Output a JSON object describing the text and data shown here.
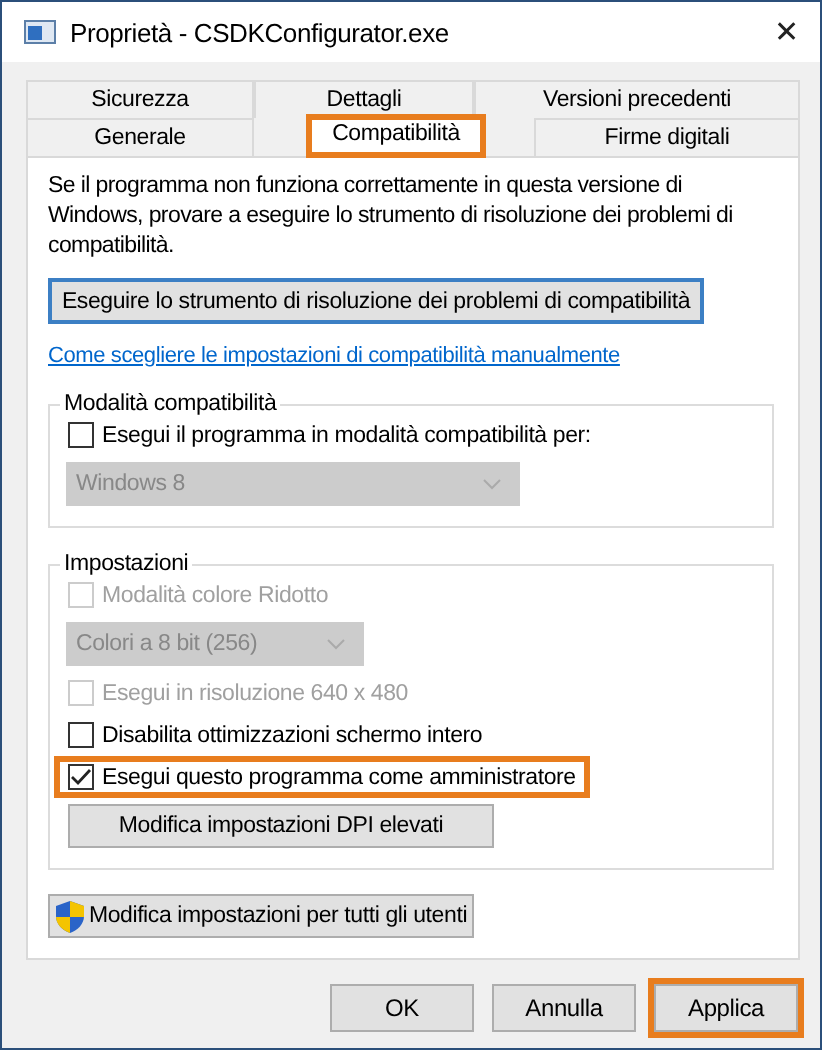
{
  "window": {
    "title": "Proprietà - CSDKConfigurator.exe",
    "close": "✕"
  },
  "tab_rows": [
    [
      {
        "label": "Sicurezza",
        "selected": false,
        "highlighted": false
      },
      {
        "label": "Dettagli",
        "selected": false,
        "highlighted": false
      },
      {
        "label": "Versioni precedenti",
        "selected": false,
        "highlighted": false
      }
    ],
    [
      {
        "label": "Generale",
        "selected": false,
        "highlighted": false
      },
      {
        "label": "Compatibilità",
        "selected": true,
        "highlighted": true
      },
      {
        "label": "Firme digitali",
        "selected": false,
        "highlighted": false
      }
    ]
  ],
  "intro": "Se il programma non funziona correttamente in questa versione di Windows, provare a eseguire lo strumento di risoluzione dei problemi di compatibilità.",
  "troubleshooter_button": "Eseguire lo strumento di risoluzione dei problemi di compatibilità",
  "manual_link": "Come scegliere le impostazioni di compatibilità manualmente",
  "groups": [
    {
      "title": "Modalità compatibilità",
      "items": [
        {
          "kind": "checkbox",
          "label": "Esegui il programma in modalità compatibilità per:",
          "checked": false,
          "disabled": false,
          "highlighted": false
        },
        {
          "kind": "dropdown",
          "value": "Windows 8",
          "disabled": true
        }
      ]
    },
    {
      "title": "Impostazioni",
      "items": [
        {
          "kind": "checkbox",
          "label": "Modalità colore Ridotto",
          "checked": false,
          "disabled": true,
          "highlighted": false
        },
        {
          "kind": "dropdown",
          "value": "Colori a 8 bit (256)",
          "disabled": true
        },
        {
          "kind": "checkbox",
          "label": "Esegui in risoluzione 640 x 480",
          "checked": false,
          "disabled": true,
          "highlighted": false
        },
        {
          "kind": "checkbox",
          "label": "Disabilita ottimizzazioni schermo intero",
          "checked": false,
          "disabled": false,
          "highlighted": false
        },
        {
          "kind": "checkbox",
          "label": "Esegui questo programma come amministratore",
          "checked": true,
          "disabled": false,
          "highlighted": true
        },
        {
          "kind": "button",
          "label": "Modifica impostazioni DPI elevati"
        }
      ]
    }
  ],
  "all_users_button": "Modifica impostazioni per tutti gli utenti",
  "buttons": [
    {
      "label": "OK",
      "highlighted": false
    },
    {
      "label": "Annulla",
      "highlighted": false
    },
    {
      "label": "Applica",
      "highlighted": true
    }
  ]
}
